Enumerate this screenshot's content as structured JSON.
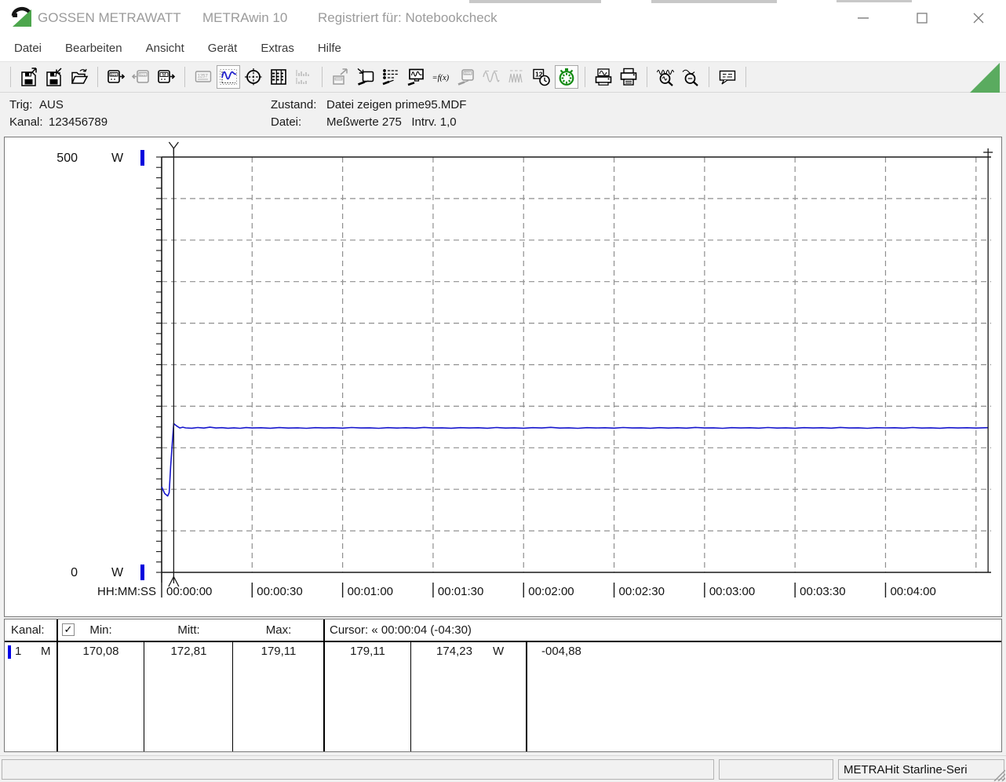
{
  "window": {
    "brand": "GOSSEN METRAWATT",
    "app": "METRAwin 10",
    "registered": "Registriert für: Notebookcheck"
  },
  "menu": {
    "items": [
      "Datei",
      "Bearbeiten",
      "Ansicht",
      "Gerät",
      "Extras",
      "Hilfe"
    ]
  },
  "toolbar": {
    "groups": [
      [
        {
          "name": "save-file-icon",
          "state": "normal"
        },
        {
          "name": "save-file-as-icon",
          "state": "normal"
        },
        {
          "name": "open-file-icon",
          "state": "normal"
        }
      ],
      [
        {
          "name": "device-read-icon",
          "state": "normal"
        },
        {
          "name": "device-stop-icon",
          "state": "disabled"
        },
        {
          "name": "device-memory-icon",
          "state": "normal"
        }
      ],
      [
        {
          "name": "multimeter-display-icon",
          "state": "disabled"
        },
        {
          "name": "chart-view-icon",
          "state": "pressed"
        },
        {
          "name": "cursor-view-icon",
          "state": "normal"
        },
        {
          "name": "table-view-icon",
          "state": "normal"
        },
        {
          "name": "histogram-view-icon",
          "state": "disabled"
        }
      ],
      [
        {
          "name": "export-device-icon",
          "state": "disabled"
        },
        {
          "name": "device-write-icon",
          "state": "normal"
        },
        {
          "name": "device-settings-icon",
          "state": "normal"
        },
        {
          "name": "monitor-settings-icon",
          "state": "normal"
        },
        {
          "name": "formula-icon",
          "state": "normal"
        },
        {
          "name": "device-config-icon",
          "state": "disabled"
        },
        {
          "name": "analog-output-icon",
          "state": "disabled"
        },
        {
          "name": "pulse-output-icon",
          "state": "disabled"
        },
        {
          "name": "time-format-icon",
          "state": "normal"
        },
        {
          "name": "realtime-clock-icon",
          "state": "pressed"
        }
      ],
      [
        {
          "name": "print-preview-icon",
          "state": "normal"
        },
        {
          "name": "print-icon",
          "state": "normal"
        }
      ],
      [
        {
          "name": "zoom-in-waves-icon",
          "state": "normal"
        },
        {
          "name": "zoom-out-waves-icon",
          "state": "normal"
        }
      ],
      [
        {
          "name": "notes-icon",
          "state": "normal"
        }
      ]
    ]
  },
  "status": {
    "trig_label": "Trig:",
    "trig_value": "AUS",
    "kanal_label": "Kanal:",
    "kanal_value": "123456789",
    "zustand_label": "Zustand:",
    "zustand_value": "Datei zeigen prime95.MDF",
    "datei_label": "Datei:",
    "datei_value": "Meßwerte 275   Intrv. 1,0"
  },
  "chart_data": {
    "type": "line",
    "title": "",
    "ylabel": "W",
    "y_unit": "W",
    "ylim": [
      0,
      500
    ],
    "y_max_label": "500",
    "y_min_label": "0",
    "y_grid_step": 50,
    "y_minor_tick_step": 12.5,
    "xlabel": "HH:MM:SS",
    "xlim_s": [
      0,
      275
    ],
    "x_tick_step_s": 30,
    "x_ticks": [
      "00:00:00",
      "00:00:30",
      "00:01:00",
      "00:01:30",
      "00:02:00",
      "00:02:30",
      "00:03:00",
      "00:03:30",
      "00:04:00"
    ],
    "grid": true,
    "channel_marker_color": "#0000dd",
    "cursors": {
      "t1_s": 4,
      "t2_s": 274,
      "label": "Cursor: « 00:00:04 (-04:30)"
    },
    "series": [
      {
        "name": "Kanal 1",
        "color": "#1717cd",
        "points": [
          [
            0,
            103
          ],
          [
            1,
            95
          ],
          [
            2,
            92
          ],
          [
            2.5,
            96
          ],
          [
            3,
            128
          ],
          [
            3.5,
            155
          ],
          [
            4,
            179.1
          ],
          [
            5,
            176.2
          ],
          [
            6,
            173.8
          ],
          [
            7,
            174.8
          ],
          [
            8,
            173.9
          ],
          [
            10,
            173.5
          ],
          [
            12,
            174.4
          ],
          [
            14,
            173.7
          ],
          [
            16,
            174.8
          ],
          [
            18,
            173.8
          ],
          [
            20,
            174.2
          ],
          [
            22,
            173.5
          ],
          [
            24,
            174.0
          ],
          [
            26,
            173.4
          ],
          [
            28,
            174.3
          ],
          [
            30,
            173.8
          ],
          [
            33,
            174.1
          ],
          [
            36,
            173.5
          ],
          [
            39,
            174.3
          ],
          [
            42,
            173.7
          ],
          [
            45,
            174.0
          ],
          [
            48,
            173.4
          ],
          [
            51,
            174.2
          ],
          [
            54,
            173.8
          ],
          [
            57,
            174.1
          ],
          [
            60,
            173.6
          ],
          [
            63,
            174.4
          ],
          [
            66,
            173.8
          ],
          [
            69,
            174.0
          ],
          [
            72,
            173.4
          ],
          [
            75,
            174.2
          ],
          [
            78,
            173.7
          ],
          [
            81,
            174.1
          ],
          [
            84,
            173.6
          ],
          [
            87,
            174.5
          ],
          [
            90,
            173.8
          ],
          [
            93,
            174.0
          ],
          [
            96,
            173.5
          ],
          [
            99,
            174.2
          ],
          [
            102,
            173.8
          ],
          [
            105,
            174.1
          ],
          [
            108,
            173.5
          ],
          [
            111,
            174.4
          ],
          [
            114,
            173.7
          ],
          [
            117,
            174.0
          ],
          [
            120,
            173.5
          ],
          [
            123,
            174.2
          ],
          [
            126,
            173.8
          ],
          [
            129,
            174.6
          ],
          [
            132,
            173.7
          ],
          [
            135,
            174.0
          ],
          [
            138,
            173.4
          ],
          [
            141,
            174.2
          ],
          [
            144,
            173.8
          ],
          [
            147,
            174.1
          ],
          [
            150,
            173.6
          ],
          [
            153,
            174.4
          ],
          [
            156,
            173.8
          ],
          [
            159,
            174.0
          ],
          [
            162,
            173.5
          ],
          [
            165,
            174.2
          ],
          [
            168,
            173.7
          ],
          [
            171,
            174.1
          ],
          [
            174,
            173.6
          ],
          [
            177,
            174.5
          ],
          [
            180,
            173.8
          ],
          [
            183,
            174.0
          ],
          [
            186,
            173.4
          ],
          [
            189,
            174.2
          ],
          [
            192,
            173.8
          ],
          [
            195,
            174.1
          ],
          [
            198,
            173.6
          ],
          [
            201,
            174.4
          ],
          [
            204,
            173.7
          ],
          [
            207,
            174.0
          ],
          [
            210,
            173.5
          ],
          [
            213,
            174.2
          ],
          [
            216,
            173.8
          ],
          [
            219,
            174.1
          ],
          [
            222,
            173.6
          ],
          [
            225,
            174.5
          ],
          [
            228,
            173.8
          ],
          [
            231,
            174.0
          ],
          [
            234,
            173.4
          ],
          [
            237,
            174.2
          ],
          [
            240,
            173.9
          ],
          [
            243,
            174.1
          ],
          [
            246,
            173.6
          ],
          [
            249,
            174.4
          ],
          [
            252,
            173.7
          ],
          [
            255,
            174.0
          ],
          [
            258,
            173.5
          ],
          [
            261,
            174.2
          ],
          [
            264,
            173.8
          ],
          [
            267,
            174.1
          ],
          [
            270,
            173.7
          ],
          [
            272,
            174.0
          ],
          [
            274,
            174.23
          ]
        ]
      }
    ]
  },
  "table": {
    "header": {
      "kanal": "Kanal:",
      "checkbox_checked": true,
      "min": "Min:",
      "mitt": "Mitt:",
      "max": "Max:",
      "cursor": "Cursor: « 00:00:04 (-04:30)"
    },
    "rows": [
      {
        "channel": "1",
        "mode": "M",
        "min": "170,08",
        "mitt": "172,81",
        "max": "179,11",
        "cursor1": "179,11",
        "cursor2": "174,23",
        "unit": "W",
        "delta": "-004,88",
        "color": "#0000e8"
      }
    ]
  },
  "statusbar": {
    "device": "METRAHit Starline-Seri"
  },
  "colors": {
    "accent_green": "#4da64d",
    "line_blue": "#1717cd",
    "channel_blue": "#0000dd"
  }
}
